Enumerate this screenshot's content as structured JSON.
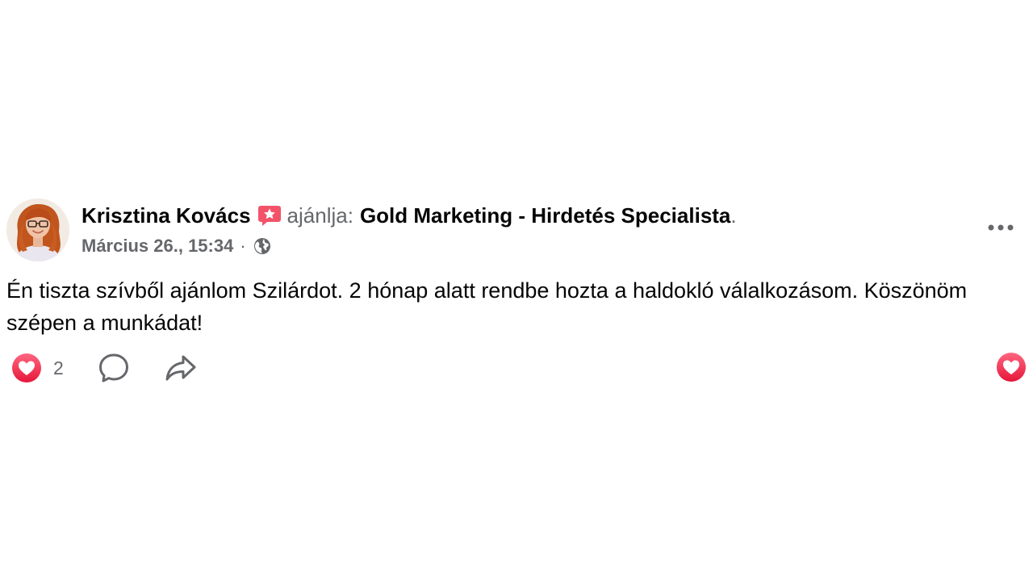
{
  "post": {
    "author": "Krisztina Kovács",
    "recommends_text": "ajánlja:",
    "page_name": "Gold Marketing - Hirdetés Specialista",
    "period": ".",
    "timestamp": "Március 26., 15:34",
    "separator": "·",
    "privacy_icon": "globe-icon",
    "recommendation_icon": "recommendation-star-icon",
    "more_icon": "more-options-icon",
    "body": "Én tiszta szívből ajánlom Szilárdot. 2 hónap alatt rendbe hozta a haldokló válalkozásom. Köszönöm szépen a munkádat!"
  },
  "actions": {
    "reaction_icon": "love-reaction-icon",
    "reaction_count": "2",
    "comment_icon": "comment-icon",
    "share_icon": "share-icon"
  },
  "colors": {
    "love_red": "#f33e58",
    "recommend_pink": "#f35369",
    "secondary_text": "#65676b",
    "primary_text": "#050505"
  }
}
